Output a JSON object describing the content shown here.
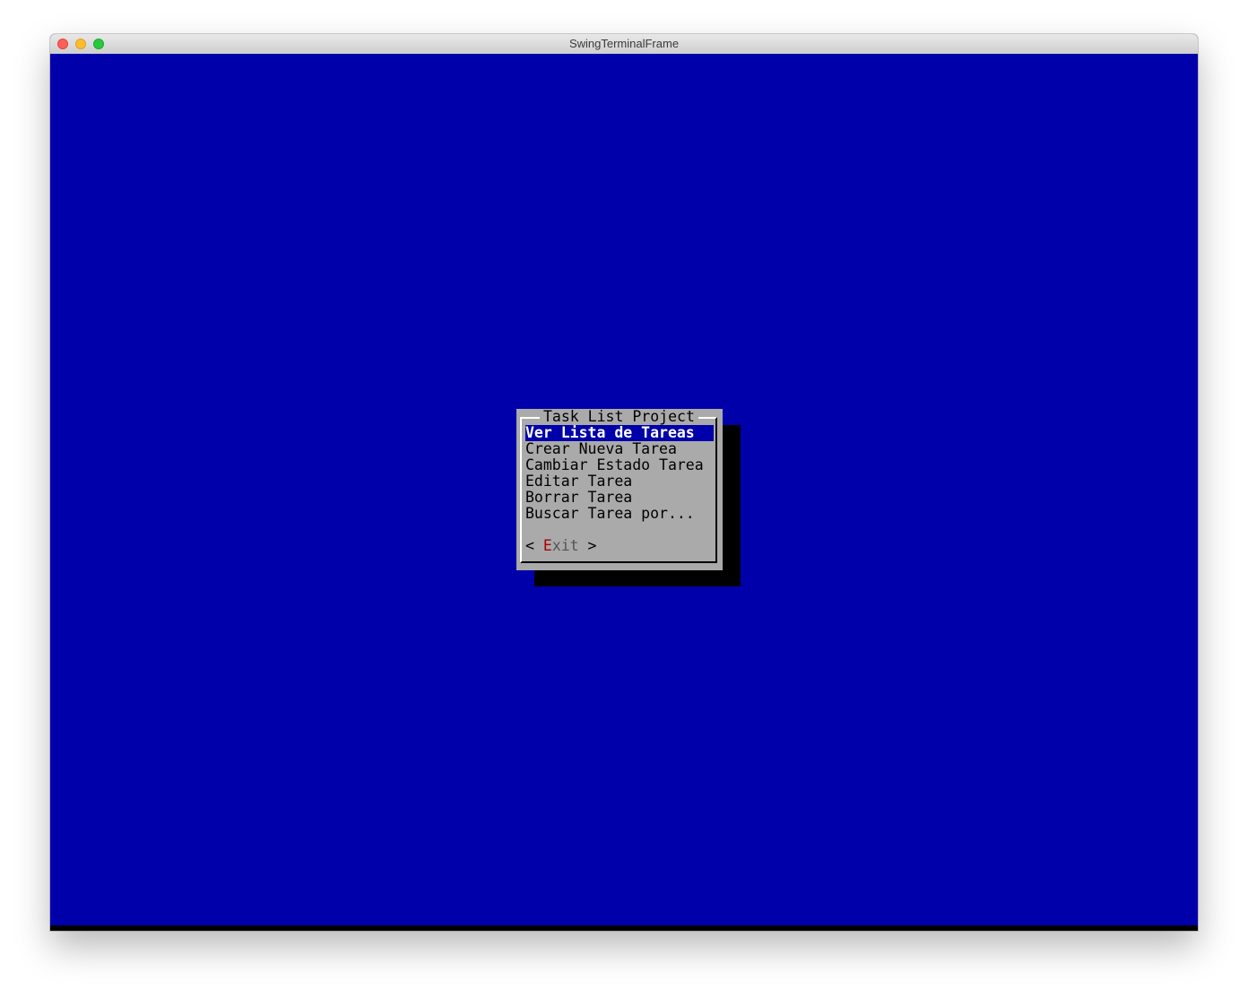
{
  "window": {
    "title": "SwingTerminalFrame"
  },
  "dialog": {
    "title": "Task List Project",
    "menu_items": [
      {
        "label": "Ver Lista de Tareas",
        "selected": true
      },
      {
        "label": "Crear Nueva Tarea",
        "selected": false
      },
      {
        "label": "Cambiar Estado Tarea",
        "selected": false
      },
      {
        "label": "Editar Tarea",
        "selected": false
      },
      {
        "label": "Borrar Tarea",
        "selected": false
      },
      {
        "label": "Buscar Tarea por...",
        "selected": false
      }
    ],
    "exit_button": {
      "left_bracket": "< ",
      "hotkey": "E",
      "rest": "xit",
      "right_bracket": " >"
    }
  },
  "colors": {
    "terminal_background": "#0000aa",
    "dialog_background": "#aaaaaa",
    "selected_background": "#0000aa",
    "selected_text": "#ffffff",
    "hotkey": "#aa0000",
    "shadow": "#000000"
  }
}
